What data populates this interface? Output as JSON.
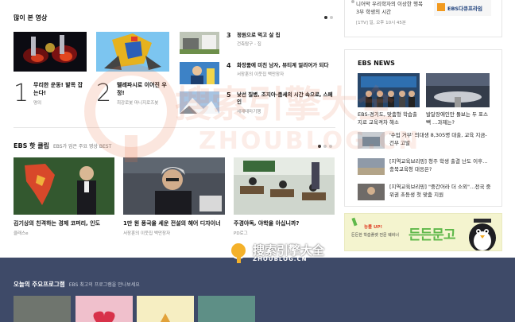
{
  "popular": {
    "title": "많이 본 영상",
    "items": [
      {
        "rank": "1",
        "title": "무리한 운동! 발목 잡는다!",
        "meta": "명의"
      },
      {
        "rank": "2",
        "title": "텔레파시로 이어진 우정!",
        "meta": "최강로봇 마니지로즈봇"
      },
      {
        "rank": "3",
        "title": "정원으로 먹고 살 집",
        "meta": "건축탐구 - 집"
      },
      {
        "rank": "4",
        "title": "화장품에 미친 남자, 뷰티계 얼리어가 되다",
        "meta": "서장훈의 이웃집 백만장자"
      },
      {
        "rank": "5",
        "title": "낯선 질병, 조지아-좀세의 시간 속으로, 스페인",
        "meta": "세계테마기행"
      }
    ]
  },
  "clips": {
    "title": "EBS 핫 클립",
    "subtitle": "EBS가 엄은 주요 영상 BEST",
    "items": [
      {
        "title": "김기상의 친격하는 경제 코퍼리, 인도",
        "meta": "클래스e"
      },
      {
        "title": "1만 원 풍국을 세운 전설의 헤어 디자이너",
        "meta": "서장훈의 이웃집 백만장자"
      },
      {
        "title": "주경야독, 야학을 아십니까?",
        "meta": "PD로그"
      }
    ]
  },
  "top_right": {
    "text": "니어막 우리학자의 이상한 행목 3부 학생의 시간",
    "meta": "[1TV] 일, 오후 10시 45분",
    "brand": "EBS다큐프라임"
  },
  "news": {
    "title": "EBS NEWS",
    "featured": [
      {
        "title": "EBS-경기도, 맞춤형 학습출지로 교육격차 해소"
      },
      {
        "title": "발달장애인만 돌보는 두 표스 빽 …과제는?"
      }
    ],
    "items": [
      {
        "title": "'수업 거부' 의대생 8,305명 대출, 교육 지금-건부 고발"
      },
      {
        "title": "[지역교육브리핑] 청주 학생 출결 난도 이후…충북교육청 대응은?"
      },
      {
        "title": "[지역교육브리핑] \"중간어라 더 소외\"…전국 중위권 초등생 첫 맞춤 지원"
      }
    ]
  },
  "banner": {
    "small": "든든한 학습플랫 전문 웨비너",
    "tag": "능률 UP!",
    "big": "든든문고"
  },
  "bottom": {
    "title": "오늘의 주요프로그램",
    "subtitle": "EBS 최고의 프로그램을 만나보세요"
  },
  "watermark": {
    "text": "搜索引擎大全",
    "url": "ZHOUBLOG.CN"
  },
  "colors": {
    "bottom_band": "#3e4a68",
    "banner_bg": "#f4f4cf",
    "banner_text": "#5fb84a"
  }
}
